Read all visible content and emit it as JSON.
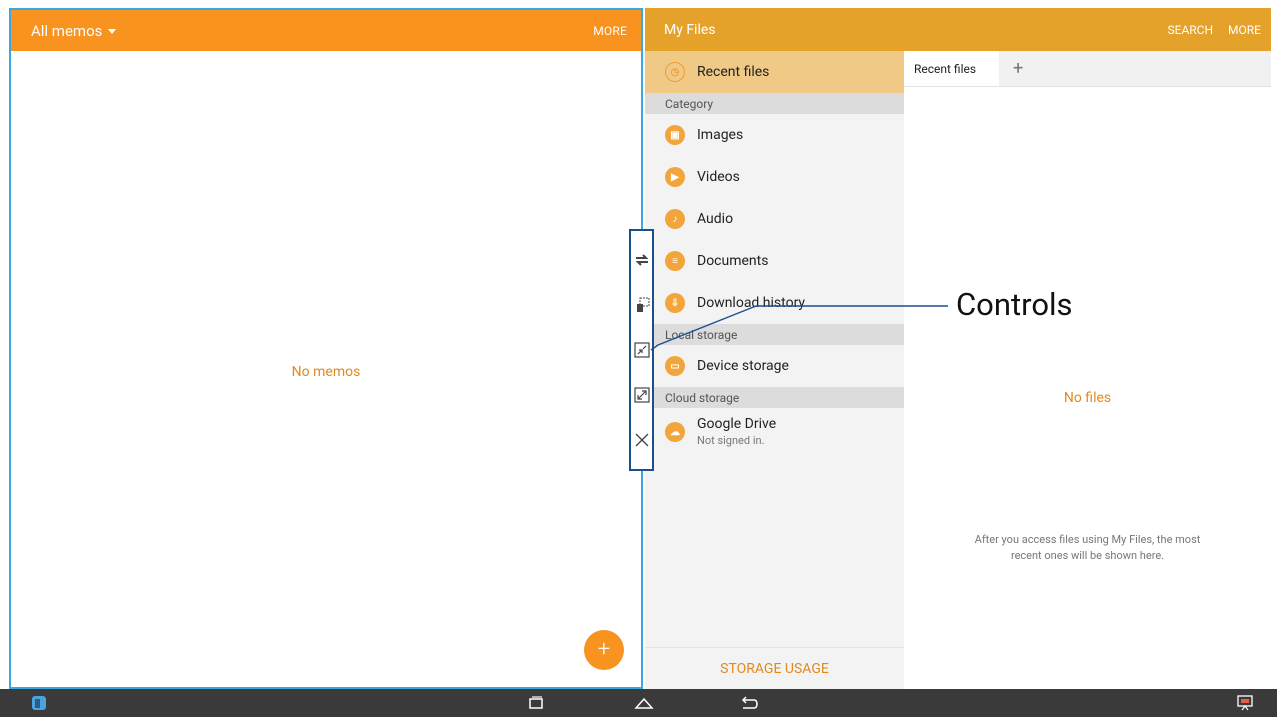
{
  "memo": {
    "title": "All memos",
    "more": "MORE",
    "empty": "No memos",
    "fab": "+"
  },
  "files": {
    "title": "My Files",
    "search": "SEARCH",
    "more": "MORE",
    "recent": "Recent files",
    "section_category": "Category",
    "categories": [
      "Images",
      "Videos",
      "Audio",
      "Documents",
      "Download history"
    ],
    "section_local": "Local storage",
    "device": "Device storage",
    "section_cloud": "Cloud storage",
    "gdrive": "Google Drive",
    "gdrive_sub": "Not signed in.",
    "storage_usage": "STORAGE USAGE",
    "tab": "Recent files",
    "tab_add": "+",
    "empty": "No files",
    "hint": "After you access files using My Files, the most recent ones will be shown here."
  },
  "annotation": {
    "label": "Controls"
  },
  "colors": {
    "memo_bar": "#f7931e",
    "files_bar": "#e5a22a",
    "accent_text": "#e08a1e",
    "highlight_border": "#3aa7e0",
    "controls_border": "#1b4f8c"
  },
  "icons": {
    "controls": [
      "swap-windows-icon",
      "drag-content-icon",
      "minimize-icon",
      "maximize-icon",
      "close-icon"
    ],
    "navbar": [
      "app-icon",
      "recent-apps-icon",
      "home-icon",
      "back-icon",
      "presentation-icon"
    ]
  }
}
